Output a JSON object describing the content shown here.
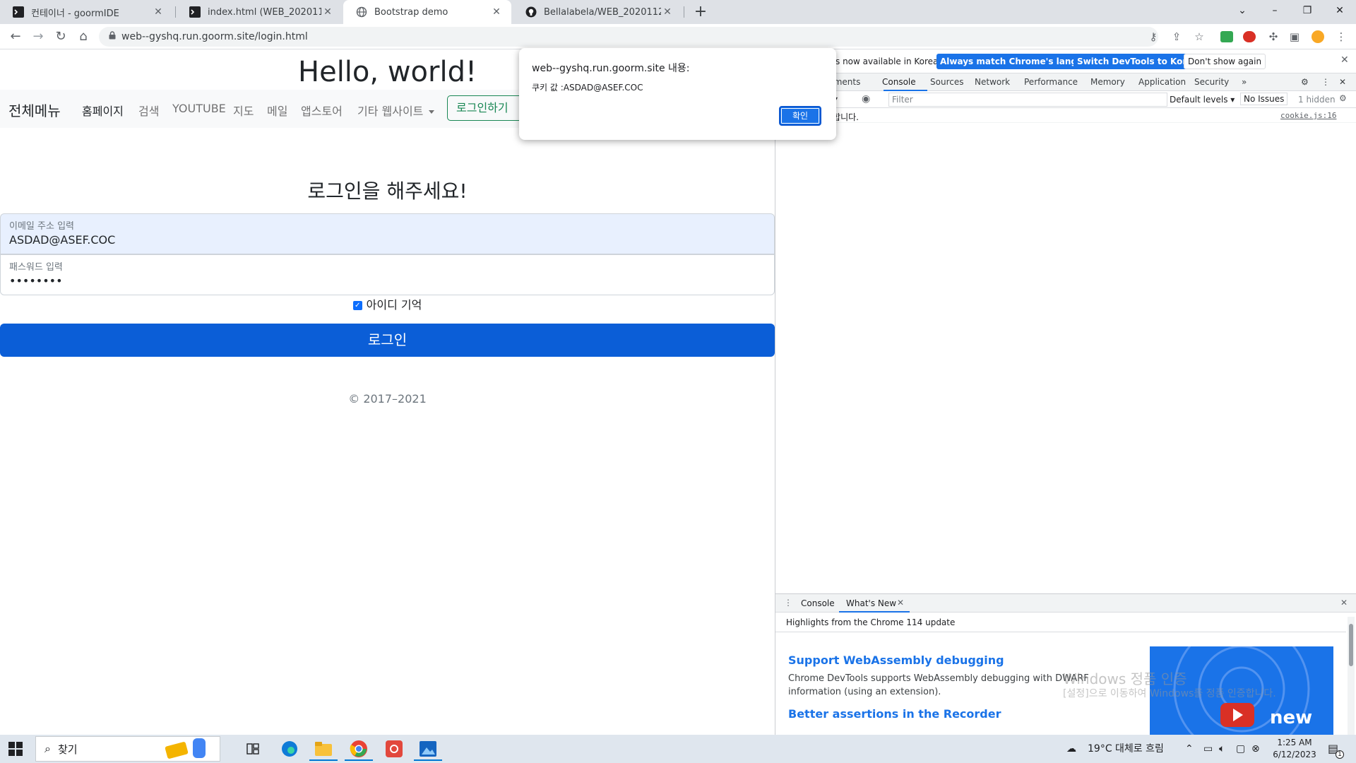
{
  "browser": {
    "tabs": [
      {
        "title": "컨테이너 - goormIDE",
        "icon": "terminal-icon"
      },
      {
        "title": "index.html (WEB_20201129) - goormIDE",
        "icon": "terminal-icon"
      },
      {
        "title": "Bootstrap demo",
        "icon": "globe-icon"
      },
      {
        "title": "Bellalabela/WEB_20201129",
        "icon": "github-icon"
      }
    ],
    "active_tab": 2,
    "url": "web--gyshq.run.goorm.site/login.html"
  },
  "page": {
    "hello": "Hello, world!",
    "nav": {
      "brand": "전체메뉴",
      "links": [
        "홈페이지",
        "검색",
        "YOUTUBE",
        "지도",
        "메일",
        "앱스토어",
        "기타 웹사이트"
      ],
      "login_button": "로그인하기"
    },
    "headline": "로그인을 해주세요!",
    "email": {
      "label": "이메일 주소 입력",
      "value": "ASDAD@ASEF.COC"
    },
    "password": {
      "label": "패스워드 입력",
      "value": "••••••••"
    },
    "remember_label": "아이디 기억",
    "remember_checked": true,
    "submit_label": "로그인",
    "copyright": "© 2017–2021"
  },
  "alert": {
    "origin": "web--gyshq.run.goorm.site 내용:",
    "message": "쿠키 값 :ASDAD@ASEF.COC",
    "ok_label": "확인"
  },
  "devtools": {
    "infobar_text": "s now available in Korean!",
    "btn_match": "Always match Chrome's language",
    "btn_switch": "Switch DevTools to Korean",
    "btn_dont": "Don't show again",
    "tabs": [
      "lements",
      "Console",
      "Sources",
      "Network",
      "Performance",
      "Memory",
      "Application",
      "Security"
    ],
    "filter_placeholder": "Filter",
    "levels": "Default levels ▾",
    "issues": "No Issues",
    "hidden": "1 hidden",
    "console_text": "했합니다.",
    "console_source": "cookie.js:16",
    "drawer_tabs": [
      "Console",
      "What's New"
    ],
    "whatsnew_header": "Highlights from the Chrome 114 update",
    "wn1_title": "Support WebAssembly debugging",
    "wn1_body": "Chrome DevTools supports WebAssembly debugging with DWARF information (using an extension).",
    "wn2_title": "Better assertions in the Recorder",
    "video_text": "new"
  },
  "watermark": {
    "line1": "Windows 정품 인증",
    "line2": "[설정]으로 이동하여 Windows를 정품 인증합니다."
  },
  "taskbar": {
    "search_placeholder": "찾기",
    "weather": "19°C  대체로 흐림",
    "time": "1:25 AM",
    "date": "6/12/2023",
    "notification_count": "1"
  },
  "colors": {
    "primary": "#0b5ed7",
    "success": "#198754",
    "devtools_blue": "#1a73e8"
  }
}
